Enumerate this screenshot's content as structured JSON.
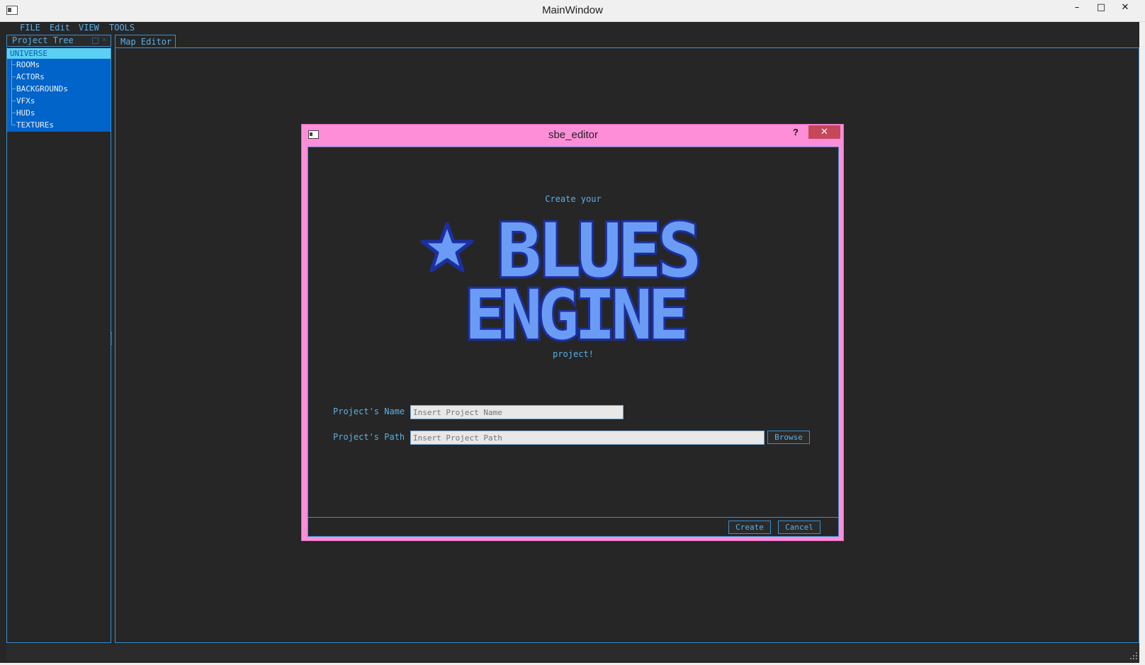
{
  "window": {
    "title": "MainWindow",
    "minimize_glyph": "–",
    "maximize_glyph": "□",
    "close_glyph": "✕"
  },
  "menu": {
    "items": [
      "FILE",
      "Edit",
      "VIEW",
      "TOOLS"
    ]
  },
  "dock": {
    "title": "Project Tree",
    "tree": {
      "root": "UNIVERSE",
      "children": [
        "ROOMs",
        "ACTORs",
        "BACKGROUNDs",
        "VFXs",
        "HUDs",
        "TEXTUREs"
      ]
    }
  },
  "tabs": {
    "map_editor": "Map Editor"
  },
  "dialog": {
    "title": "sbe_editor",
    "help_glyph": "?",
    "close_glyph": "✕",
    "intro": "Create your",
    "logo_line1": "BLUES",
    "logo_line2": "ENGINE",
    "outro": "project!",
    "name_label": "Project's Name",
    "name_placeholder": "Insert Project Name",
    "path_label": "Project's Path",
    "path_placeholder": "Insert Project Path",
    "browse_label": "Browse",
    "create_label": "Create",
    "cancel_label": "Cancel"
  },
  "colors": {
    "accent": "#5ab0e8",
    "background": "#262626",
    "dialog_border": "#ff8ed8",
    "tree_selected": "#5bd0f5",
    "tree_items": "#0064c8",
    "close_button": "#c7475a",
    "logo_fill": "#6a9cf5",
    "logo_outline": "#1d2fa0"
  },
  "icons": {
    "app": "window-icon",
    "logo_star": "star-icon"
  }
}
